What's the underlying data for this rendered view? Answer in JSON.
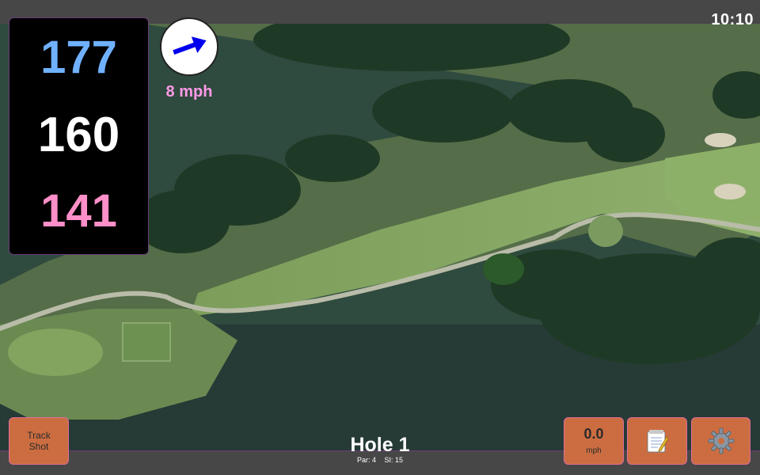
{
  "status": {
    "time": "10:10"
  },
  "distances": {
    "back": "177",
    "middle": "160",
    "front": "141"
  },
  "wind": {
    "speed": "8 mph",
    "direction": "east-northeast",
    "arrow_color": "#0000ee"
  },
  "track_button": {
    "line1": "Track",
    "line2": "Shot"
  },
  "hole": {
    "title": "Hole 1",
    "par": "Par: 4",
    "si": "SI: 15"
  },
  "speed_button": {
    "value": "0.0",
    "unit": "mph"
  },
  "icons": {
    "notes": "notepad-icon",
    "settings": "gear-icon"
  },
  "colors": {
    "button": "#cc6d41",
    "back_distance": "#6fb1ff",
    "middle_distance": "#ffffff",
    "front_distance": "#ff8fc8",
    "wind_text": "#ff99e6"
  }
}
